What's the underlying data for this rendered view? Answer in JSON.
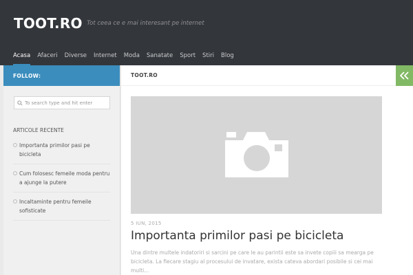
{
  "header": {
    "logo": "TOOT.RO",
    "tagline": "Tot ceea ce e mai interesant pe internet",
    "nav": [
      "Acasa",
      "Afaceri",
      "Diverse",
      "Internet",
      "Moda",
      "Sanatate",
      "Sport",
      "Stiri",
      "Blog"
    ],
    "active_nav": "Acasa"
  },
  "sidebar": {
    "follow_label": "FOLLOW:",
    "search": {
      "placeholder": "To search type and hit enter",
      "value": ""
    },
    "widget_title": "ARTICOLE RECENTE",
    "recent": [
      "Importanta primilor pasi pe bicicleta",
      "Cum folosesc femeile moda pentru a ajunge la putere",
      "Incaltaminte pentru femeile sofisticate"
    ]
  },
  "main": {
    "heading": "TOOT.RO",
    "toggle_icon": "double-chevron-left-icon",
    "post": {
      "thumbnail_icon": "camera-icon",
      "date": "5 IUN, 2015",
      "title": "Importanta primilor pasi pe bicicleta",
      "excerpt": "Una dintre multele indatoriri si sarcini pe care le au parintii este sa invete copiii sa mearga pe bicicleta. La fiecare stagiu al procesului de invatare, exista cateva abordari posibile si cei mai multi..."
    }
  },
  "colors": {
    "header_bg": "#33363b",
    "accent_blue": "#3b8dbd",
    "accent_green": "#82b965",
    "sidebar_bg": "#f0f0f0"
  }
}
